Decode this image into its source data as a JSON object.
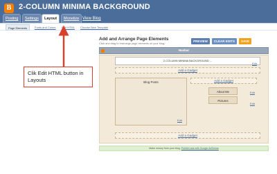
{
  "header": {
    "logo_letter": "B",
    "blog_title": "2-COLUMN MINIMA BACKGROUND",
    "tabs": [
      "Posting",
      "Settings",
      "Layout",
      "Monetize"
    ],
    "active_tab": "Layout",
    "view_blog": "View Blog"
  },
  "subtabs": {
    "items": [
      "Page Elements",
      "Fonts and Colors",
      "Edit HTML",
      "Choose New Template"
    ],
    "active": "Page Elements"
  },
  "main": {
    "title": "Add and Arrange Page Elements",
    "subtitle": "Click and drag to rearrange page elements on your blog.",
    "buttons": {
      "preview": "PREVIEW",
      "clear_edits": "CLEAR EDITS",
      "save": "SAVE"
    }
  },
  "layout": {
    "navbar_label": "Navbar",
    "navbar_edit": "Edit",
    "header_gadget": "2-COLUMN MINIMA BACKGROUND ...",
    "header_edit": "Edit",
    "add_gadget": "Add a Gadget",
    "blog_posts": "Blog Posts",
    "blog_posts_edit": "Edit",
    "sidebar_add_gadget": "Add a Gadget",
    "about_me": "About Me",
    "about_me_edit": "Edit",
    "pictures": "Pictures",
    "pictures_edit": "Edit",
    "bottom_add_gadget": "Add a Gadget"
  },
  "footer": {
    "text": "Make money from your blog.",
    "link": "Publish ads with Google AdSense"
  },
  "annotation": {
    "text": "Clik Edit HTML button in Layouts"
  },
  "colors": {
    "header_bg": "#4b6d99",
    "accent_orange": "#f57d00",
    "callout_border": "#d8402e"
  }
}
